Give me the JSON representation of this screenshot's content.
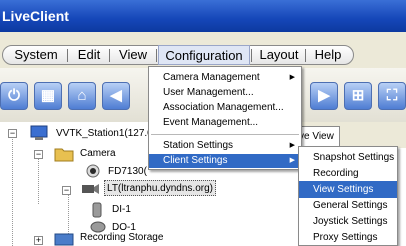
{
  "app": {
    "title": "LiveClient"
  },
  "menubar": {
    "items": [
      "System",
      "Edit",
      "View",
      "Configuration",
      "Layout",
      "Help"
    ]
  },
  "toolbar": {
    "buttons": [
      "power-icon",
      "grid-icon",
      "lock-icon",
      "speaker-icon",
      "video-icon",
      "window-icon",
      "expand-icon"
    ]
  },
  "tree": {
    "station": "VVTK_Station1(127.0",
    "camera": "Camera",
    "fd": "FD7130(",
    "lt": "LT(ltranphu.dyndns.org)",
    "di": "DI-1",
    "do": "DO-1",
    "storage": "Recording Storage"
  },
  "tab": {
    "label": "ve View"
  },
  "config_menu": {
    "items": [
      {
        "label": "Camera Management",
        "submenu": true
      },
      {
        "label": "User Management..."
      },
      {
        "label": "Association Management..."
      },
      {
        "label": "Event Management..."
      },
      {
        "label": "Station Settings",
        "submenu": true
      },
      {
        "label": "Client Settings",
        "submenu": true,
        "highlighted": true
      }
    ]
  },
  "client_submenu": {
    "items": [
      {
        "label": "Snapshot Settings"
      },
      {
        "label": "Recording Settings"
      },
      {
        "label": "View Settings",
        "highlighted": true
      },
      {
        "label": "General Settings"
      },
      {
        "label": "Joystick Settings"
      },
      {
        "label": "Proxy Settings"
      }
    ]
  },
  "colors": {
    "highlight": "#316ac5",
    "titlebar": "#1546b8"
  }
}
